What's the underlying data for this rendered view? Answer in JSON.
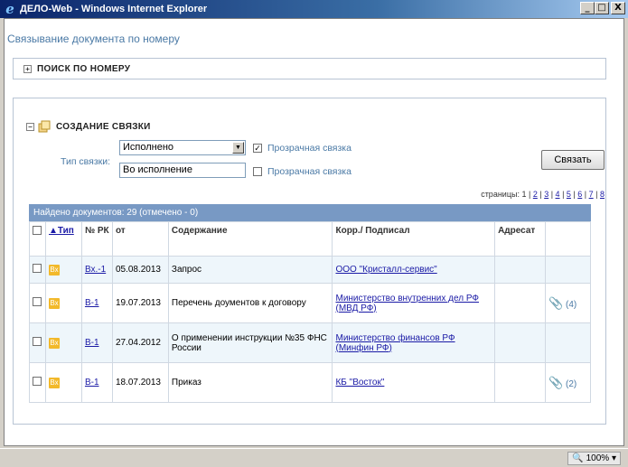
{
  "window": {
    "title": "ДЕЛО-Web - Windows Internet Explorer",
    "min": "_",
    "max": "□",
    "close": "X"
  },
  "page": {
    "title": "Связывание документа по номеру"
  },
  "search_panel": {
    "toggle": "+",
    "title": "ПОИСК ПО НОМЕРУ"
  },
  "create_panel": {
    "toggle": "−",
    "title": "СОЗДАНИЕ СВЯЗКИ",
    "link_type_label": "Тип связки:",
    "select_value": "Исполнено",
    "checkbox1_checked": "✓",
    "checkbox1_label": "Прозрачная связка",
    "input_value": "Во исполнение",
    "checkbox2_label": "Прозрачная связка",
    "link_button": "Связать"
  },
  "pager": {
    "label": "страницы:",
    "current": "1",
    "pages": [
      "2",
      "3",
      "4",
      "5",
      "6",
      "7",
      "8"
    ]
  },
  "grid": {
    "caption": "Найдено документов: 29 (отмечено - 0)",
    "columns": {
      "type": "▲Тип",
      "rk": "№ РК",
      "from": "от",
      "content": "Содержание",
      "corr": "Корр./ Подписал",
      "addressee": "Адресат"
    },
    "rows": [
      {
        "type": "Вх",
        "rk": "Вх.-1",
        "date": "05.08.2013",
        "content": "Запрос",
        "corr": "ООО \"Кристалл-сервис\"",
        "attach": ""
      },
      {
        "type": "Вх",
        "rk": "В-1",
        "date": "19.07.2013",
        "content": "Перечень доументов к договору",
        "corr": "Министерство внутренних дел РФ (МВД РФ)",
        "attach": "(4)"
      },
      {
        "type": "Вх",
        "rk": "В-1",
        "date": "27.04.2012",
        "content": "О применении инструкции №35 ФНС России",
        "corr": "Министерство финансов РФ (Минфин РФ)",
        "attach": ""
      },
      {
        "type": "Вх",
        "rk": "В-1",
        "date": "18.07.2013",
        "content": "Приказ",
        "corr": "КБ \"Восток\"",
        "attach": "(2)"
      }
    ]
  },
  "status": {
    "zoom": "100%"
  }
}
